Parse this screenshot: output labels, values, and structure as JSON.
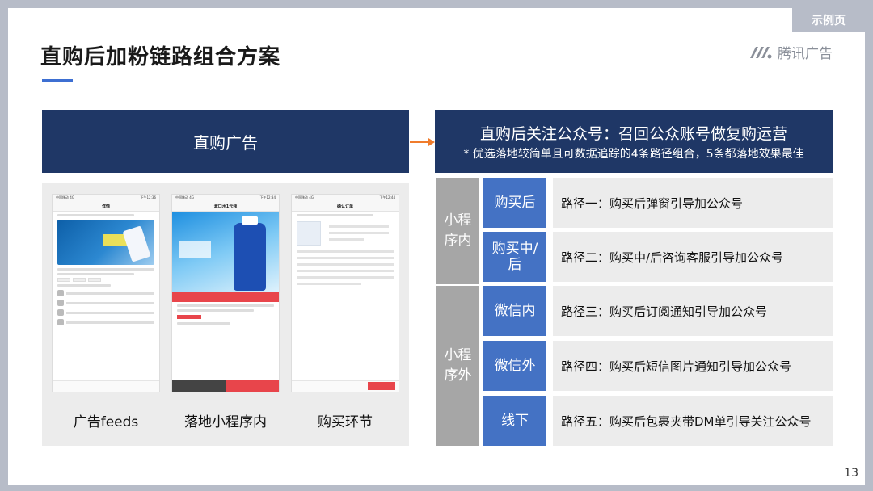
{
  "tag": "示例页",
  "title": "直购后加粉链路组合方案",
  "brand": {
    "name": "腾讯广告",
    "icon": "tencent-ads-logo-icon"
  },
  "page_number": "13",
  "left": {
    "header": "直购广告",
    "phones": [
      {
        "caption": "广告feeds",
        "status_left": "中国移动 4G",
        "status_time": "下午12:36",
        "nav_title": "详情"
      },
      {
        "caption": "落地小程序内",
        "status_left": "中国移动 4G",
        "status_time": "下午12:34",
        "nav_title": "漱口水1元领"
      },
      {
        "caption": "购买环节",
        "status_left": "中国移动 4G",
        "status_time": "下午12:44",
        "nav_title": "确认订单"
      }
    ]
  },
  "right": {
    "header_main": "直购后关注公众号：召回公众账号做复购运营",
    "header_sub": "* 优选落地较简单且可数据追踪的4条路径组合，5条都落地效果最佳",
    "groups": [
      {
        "label": "小程\n序内"
      },
      {
        "label": "小程\n序外"
      }
    ],
    "rows": [
      {
        "category": "购买后",
        "path": "路径一：购买后弹窗引导加公众号"
      },
      {
        "category": "购买中/\n后",
        "path": "路径二：购买中/后咨询客服引导加公众号"
      },
      {
        "category": "微信内",
        "path": "路径三：购买后订阅通知引导加公众号"
      },
      {
        "category": "微信外",
        "path": "路径四：购买后短信图片通知引导加公众号"
      },
      {
        "category": "线下",
        "path": "路径五：购买后包裹夹带DM单引导关注公众号"
      }
    ]
  },
  "colors": {
    "navy": "#1f3766",
    "blue": "#4472c4",
    "gray": "#a6a6a6",
    "light_gray": "#ececec",
    "arrow": "#f07c2c",
    "accent": "#3d6fd2"
  }
}
